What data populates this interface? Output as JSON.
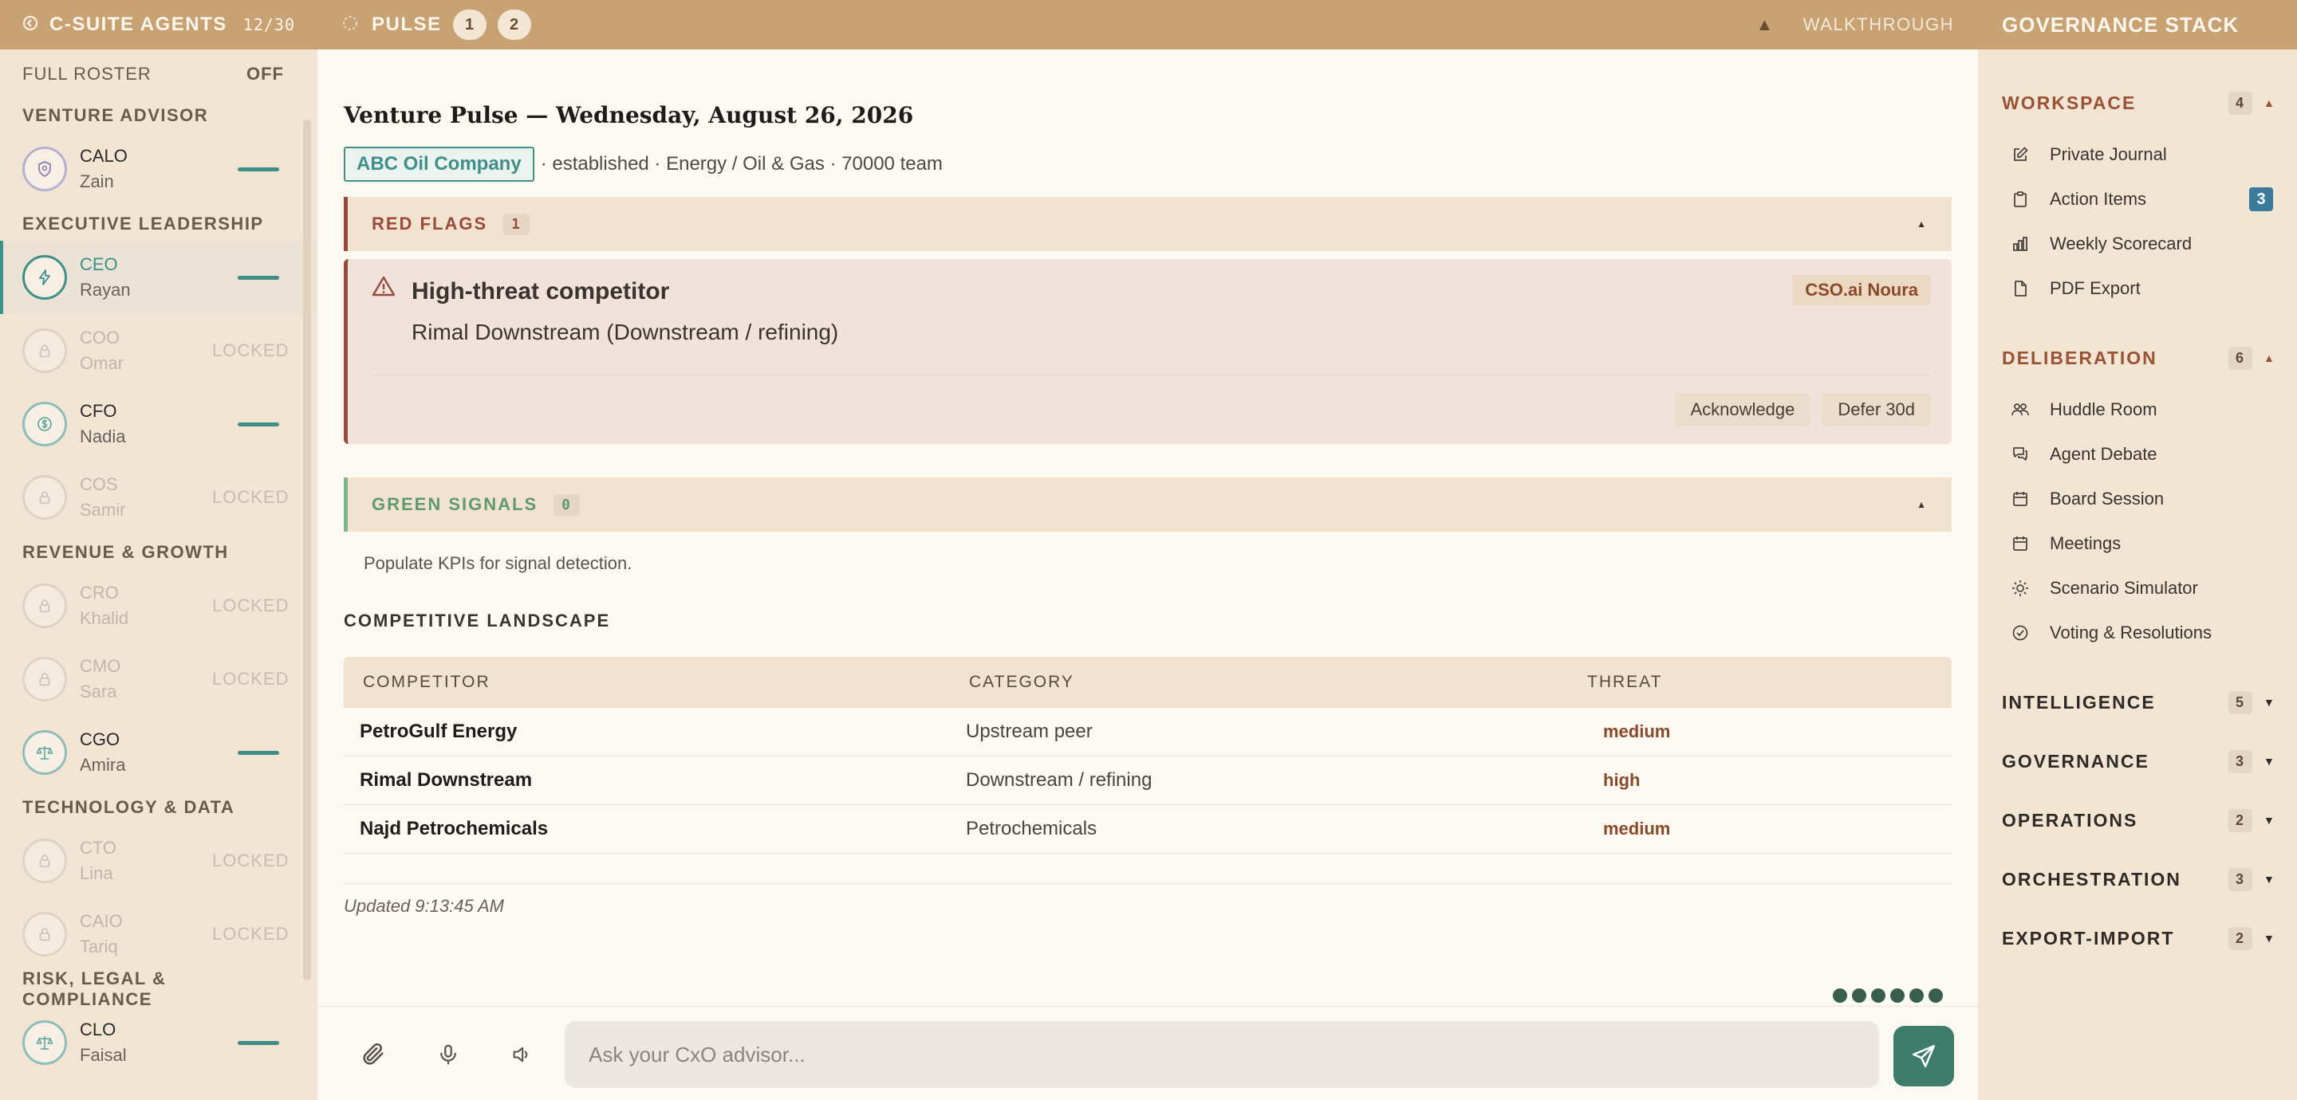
{
  "left": {
    "title": "C-SUITE AGENTS",
    "count": "12/30",
    "roster_label": "FULL ROSTER",
    "roster_state": "OFF",
    "groups": [
      {
        "name": "VENTURE ADVISOR",
        "agents": [
          {
            "role": "CALO",
            "name": "Zain",
            "status": "active",
            "icon": "shield-icon"
          }
        ]
      },
      {
        "name": "EXECUTIVE LEADERSHIP",
        "agents": [
          {
            "role": "CEO",
            "name": "Rayan",
            "status": "active",
            "icon": "bolt-icon",
            "selected": true
          },
          {
            "role": "COO",
            "name": "Omar",
            "status": "locked",
            "icon": "lock-icon"
          },
          {
            "role": "CFO",
            "name": "Nadia",
            "status": "active",
            "icon": "dollar-icon"
          },
          {
            "role": "COS",
            "name": "Samir",
            "status": "locked",
            "icon": "lock-icon"
          }
        ]
      },
      {
        "name": "REVENUE & GROWTH",
        "agents": [
          {
            "role": "CRO",
            "name": "Khalid",
            "status": "locked",
            "icon": "lock-icon"
          },
          {
            "role": "CMO",
            "name": "Sara",
            "status": "locked",
            "icon": "lock-icon"
          },
          {
            "role": "CGO",
            "name": "Amira",
            "status": "active",
            "icon": "scales-icon"
          }
        ]
      },
      {
        "name": "TECHNOLOGY & DATA",
        "agents": [
          {
            "role": "CTO",
            "name": "Lina",
            "status": "locked",
            "icon": "lock-icon"
          },
          {
            "role": "CAIO",
            "name": "Tariq",
            "status": "locked",
            "icon": "lock-icon"
          }
        ]
      },
      {
        "name": "RISK, LEGAL & COMPLIANCE",
        "agents": [
          {
            "role": "CLO",
            "name": "Faisal",
            "status": "active",
            "icon": "scales-icon"
          }
        ]
      }
    ],
    "locked_label": "LOCKED"
  },
  "topbar": {
    "title": "PULSE",
    "pills": [
      "1",
      "2"
    ],
    "walkthrough": "WALKTHROUGH"
  },
  "main": {
    "title": "Venture Pulse — Wednesday, August 26, 2026",
    "company": "ABC Oil Company",
    "meta": "· established · Energy / Oil & Gas · 70000 team",
    "red_flags": {
      "label": "RED FLAGS",
      "count": "1"
    },
    "flag": {
      "title": "High-threat competitor",
      "detail": "Rimal Downstream (Downstream / refining)",
      "source": "CSO.ai Noura",
      "actions": [
        "Acknowledge",
        "Defer 30d"
      ]
    },
    "green_signals": {
      "label": "GREEN SIGNALS",
      "count": "0",
      "message": "Populate KPIs for signal detection."
    },
    "landscape": {
      "title": "COMPETITIVE LANDSCAPE",
      "columns": [
        "COMPETITOR",
        "CATEGORY",
        "THREAT"
      ],
      "rows": [
        {
          "competitor": "PetroGulf Energy",
          "category": "Upstream peer",
          "threat": "medium"
        },
        {
          "competitor": "Rimal Downstream",
          "category": "Downstream / refining",
          "threat": "high"
        },
        {
          "competitor": "Najd Petrochemicals",
          "category": "Petrochemicals",
          "threat": "medium"
        }
      ]
    },
    "updated": "Updated 9:13:45 AM"
  },
  "composer": {
    "placeholder": "Ask your CxO advisor..."
  },
  "right": {
    "title": "GOVERNANCE STACK",
    "sections": [
      {
        "name": "WORKSPACE",
        "count": "4",
        "open": true,
        "items": [
          {
            "label": "Private Journal",
            "icon": "pencil-square-icon"
          },
          {
            "label": "Action Items",
            "icon": "clipboard-icon",
            "badge": "3"
          },
          {
            "label": "Weekly Scorecard",
            "icon": "bar-chart-icon"
          },
          {
            "label": "PDF Export",
            "icon": "file-icon"
          }
        ]
      },
      {
        "name": "DELIBERATION",
        "count": "6",
        "open": true,
        "items": [
          {
            "label": "Huddle Room",
            "icon": "people-icon"
          },
          {
            "label": "Agent Debate",
            "icon": "chat-icon"
          },
          {
            "label": "Board Session",
            "icon": "calendar-icon"
          },
          {
            "label": "Meetings",
            "icon": "calendar-icon"
          },
          {
            "label": "Scenario Simulator",
            "icon": "sun-icon"
          },
          {
            "label": "Voting & Resolutions",
            "icon": "check-circle-icon"
          }
        ]
      },
      {
        "name": "INTELLIGENCE",
        "count": "5",
        "open": false,
        "items": []
      },
      {
        "name": "GOVERNANCE",
        "count": "3",
        "open": false,
        "items": []
      },
      {
        "name": "OPERATIONS",
        "count": "2",
        "open": false,
        "items": []
      },
      {
        "name": "ORCHESTRATION",
        "count": "3",
        "open": false,
        "items": []
      },
      {
        "name": "EXPORT-IMPORT",
        "count": "2",
        "open": false,
        "items": []
      }
    ]
  }
}
